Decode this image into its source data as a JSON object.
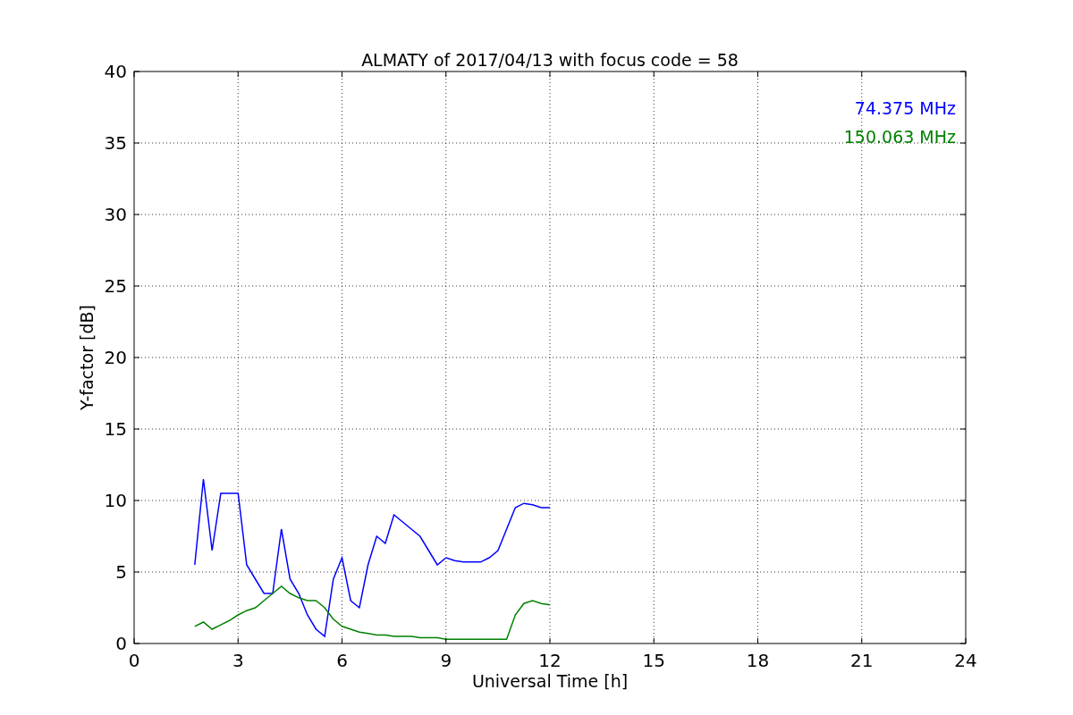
{
  "chart_data": {
    "type": "line",
    "title": "ALMATY of 2017/04/13 with focus code = 58",
    "xlabel": "Universal Time [h]",
    "ylabel": "Y-factor [dB]",
    "x": [
      1.75,
      2,
      2.25,
      2.5,
      2.75,
      3,
      3.25,
      3.5,
      3.75,
      4,
      4.25,
      4.5,
      4.75,
      5,
      5.25,
      5.5,
      5.75,
      6,
      6.25,
      6.5,
      6.75,
      7,
      7.25,
      7.5,
      7.75,
      8,
      8.25,
      8.5,
      8.75,
      9,
      9.25,
      9.5,
      9.75,
      10,
      10.25,
      10.5,
      10.75,
      11,
      11.25,
      11.5,
      11.75,
      12
    ],
    "series": [
      {
        "name": "74.375 MHz",
        "color": "#0000ff",
        "values": [
          5.5,
          11.5,
          6.5,
          10.5,
          10.5,
          10.5,
          5.5,
          4.5,
          3.5,
          3.5,
          8,
          4.5,
          3.5,
          2,
          1,
          0.5,
          4.5,
          6,
          3,
          2.5,
          5.5,
          7.5,
          7,
          9,
          8.5,
          8,
          7.5,
          6.5,
          5.5,
          6,
          5.8,
          5.7,
          5.7,
          5.7,
          6,
          6.5,
          8,
          9.5,
          9.8,
          9.7,
          9.5,
          9.5
        ]
      },
      {
        "name": "150.063 MHz",
        "color": "#008000",
        "values": [
          1.2,
          1.5,
          1,
          1.3,
          1.6,
          2,
          2.3,
          2.5,
          3,
          3.5,
          4,
          3.5,
          3.2,
          3,
          3,
          2.5,
          1.7,
          1.2,
          1,
          0.8,
          0.7,
          0.6,
          0.6,
          0.5,
          0.5,
          0.5,
          0.4,
          0.4,
          0.4,
          0.3,
          0.3,
          0.3,
          0.3,
          0.3,
          0.3,
          0.3,
          0.3,
          2,
          2.8,
          3,
          2.8,
          2.7
        ]
      }
    ],
    "grid": true,
    "xlim": [
      0,
      24
    ],
    "ylim": [
      0,
      40
    ],
    "xticks": [
      0,
      3,
      6,
      9,
      12,
      15,
      18,
      21,
      24
    ],
    "yticks": [
      0,
      5,
      10,
      15,
      20,
      25,
      30,
      35,
      40
    ]
  }
}
